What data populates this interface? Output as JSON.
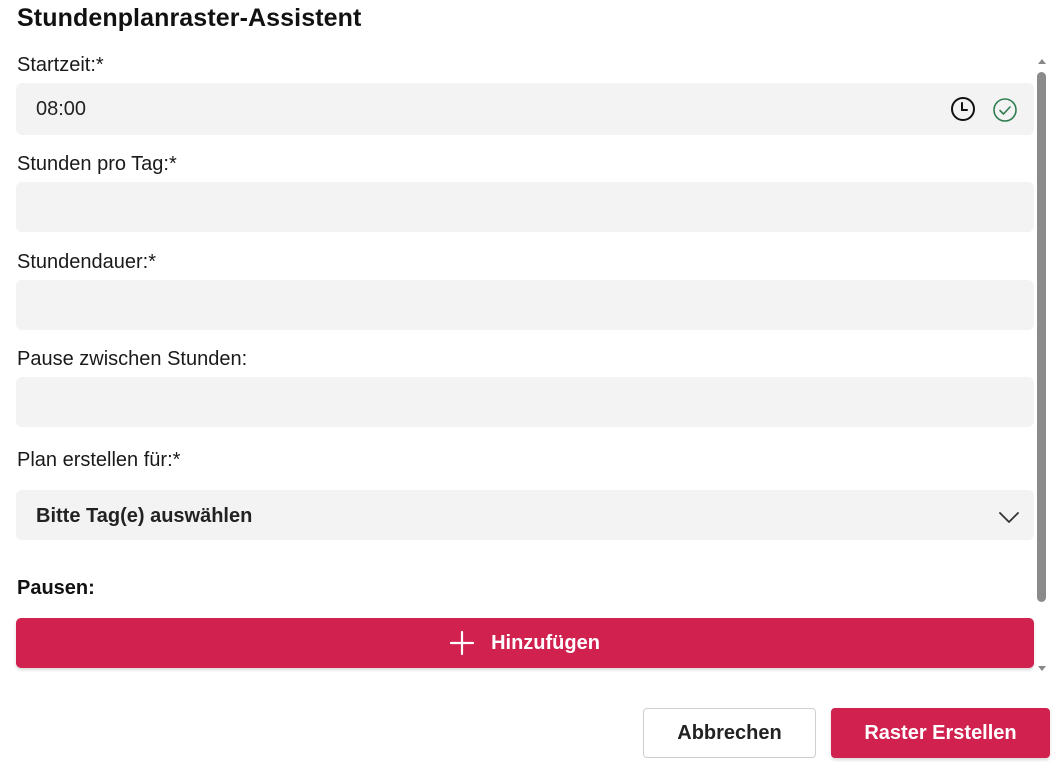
{
  "dialog": {
    "title": "Stundenplanraster-Assistent"
  },
  "form": {
    "start_time": {
      "label": "Startzeit:*",
      "value": "08:00"
    },
    "hours_per_day": {
      "label": "Stunden pro Tag:*",
      "value": ""
    },
    "lesson_duration": {
      "label": "Stundendauer:*",
      "value": ""
    },
    "break_between": {
      "label": "Pause zwischen Stunden:",
      "value": ""
    },
    "plan_for": {
      "label": "Plan erstellen für:*",
      "selected": "Bitte Tag(e) auswählen"
    }
  },
  "breaks": {
    "label": "Pausen:",
    "add_label": "Hinzufügen"
  },
  "footer": {
    "cancel_label": "Abbrechen",
    "create_label": "Raster Erstellen"
  },
  "colors": {
    "accent": "#d0214f",
    "field_bg": "#f3f3f3",
    "valid_check": "#2e7d4f"
  },
  "icons": [
    "clock-icon",
    "check-circle-icon",
    "chevron-down-icon",
    "plus-icon"
  ]
}
